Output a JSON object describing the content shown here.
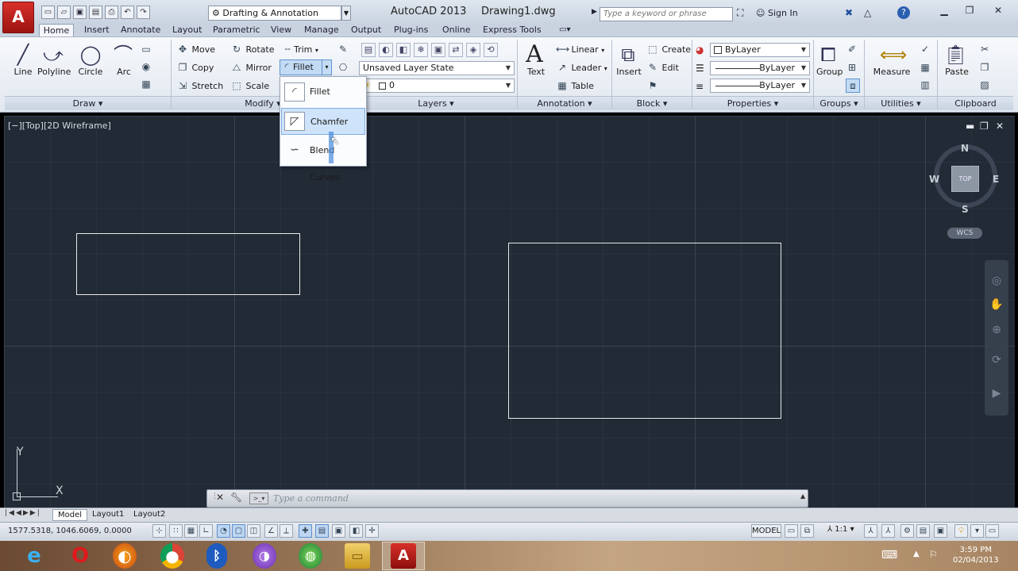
{
  "titlebar": {
    "app_button_glyph": "A",
    "workspace": "Drafting & Annotation",
    "app_title": "AutoCAD 2013",
    "doc_title": "Drawing1.dwg",
    "search_placeholder": "Type a keyword or phrase",
    "sign_in": "Sign In",
    "qat_icons": [
      "new-icon",
      "open-icon",
      "save-icon",
      "saveas-icon",
      "plot-icon",
      "undo-icon",
      "redo-icon"
    ]
  },
  "ribbon_tabs": [
    "Home",
    "Insert",
    "Annotate",
    "Layout",
    "Parametric",
    "View",
    "Manage",
    "Output",
    "Plug-ins",
    "Online",
    "Express Tools"
  ],
  "panels": {
    "draw": {
      "title": "Draw",
      "tools": [
        "Line",
        "Polyline",
        "Circle",
        "Arc"
      ]
    },
    "modify": {
      "title": "Modify",
      "move": "Move",
      "rotate": "Rotate",
      "trim": "Trim",
      "copy": "Copy",
      "mirror": "Mirror",
      "fillet": "Fillet",
      "stretch": "Stretch",
      "scale": "Scale"
    },
    "layers": {
      "title": "Layers",
      "layer_state": "Unsaved Layer State",
      "current_layer": "0"
    },
    "annotation": {
      "title": "Annotation",
      "text": "Text",
      "linear": "Linear",
      "leader": "Leader",
      "table": "Table"
    },
    "block": {
      "title": "Block",
      "insert": "Insert",
      "create": "Create",
      "edit": "Edit"
    },
    "properties": {
      "title": "Properties",
      "color": "ByLayer",
      "linetype": "ByLayer",
      "lineweight": "ByLayer"
    },
    "groups": {
      "title": "Groups",
      "group": "Group"
    },
    "utilities": {
      "title": "Utilities",
      "measure": "Measure"
    },
    "clipboard": {
      "title": "Clipboard",
      "paste": "Paste"
    }
  },
  "fillet_menu": {
    "items": [
      "Fillet",
      "Chamfer",
      "Blend Curves"
    ],
    "highlighted": "Chamfer"
  },
  "viewport": {
    "label": "[−][Top][2D Wireframe]",
    "viewcube": {
      "top": "TOP",
      "n": "N",
      "s": "S",
      "e": "E",
      "w": "W"
    },
    "wcs": "WCS",
    "ucs_x": "X",
    "ucs_y": "Y"
  },
  "command_line": {
    "placeholder": "Type a command"
  },
  "layout_tabs": [
    "Model",
    "Layout1",
    "Layout2"
  ],
  "status_bar": {
    "coordinates": "1577.5318, 1046.6069, 0.0000",
    "model": "MODEL",
    "scale": "1:1"
  },
  "taskbar": {
    "apps": [
      "internet-explorer-icon",
      "opera-icon",
      "firefox-icon",
      "chrome-icon",
      "bluetooth-icon",
      "media-player-icon",
      "network-globe-icon",
      "file-explorer-icon",
      "autocad-icon"
    ],
    "time": "3:59 PM",
    "date": "02/04/2013"
  },
  "colors": {
    "canvas": "#222a36",
    "geometry": "#e8e8e8",
    "highlight": "#cfe3fa"
  }
}
